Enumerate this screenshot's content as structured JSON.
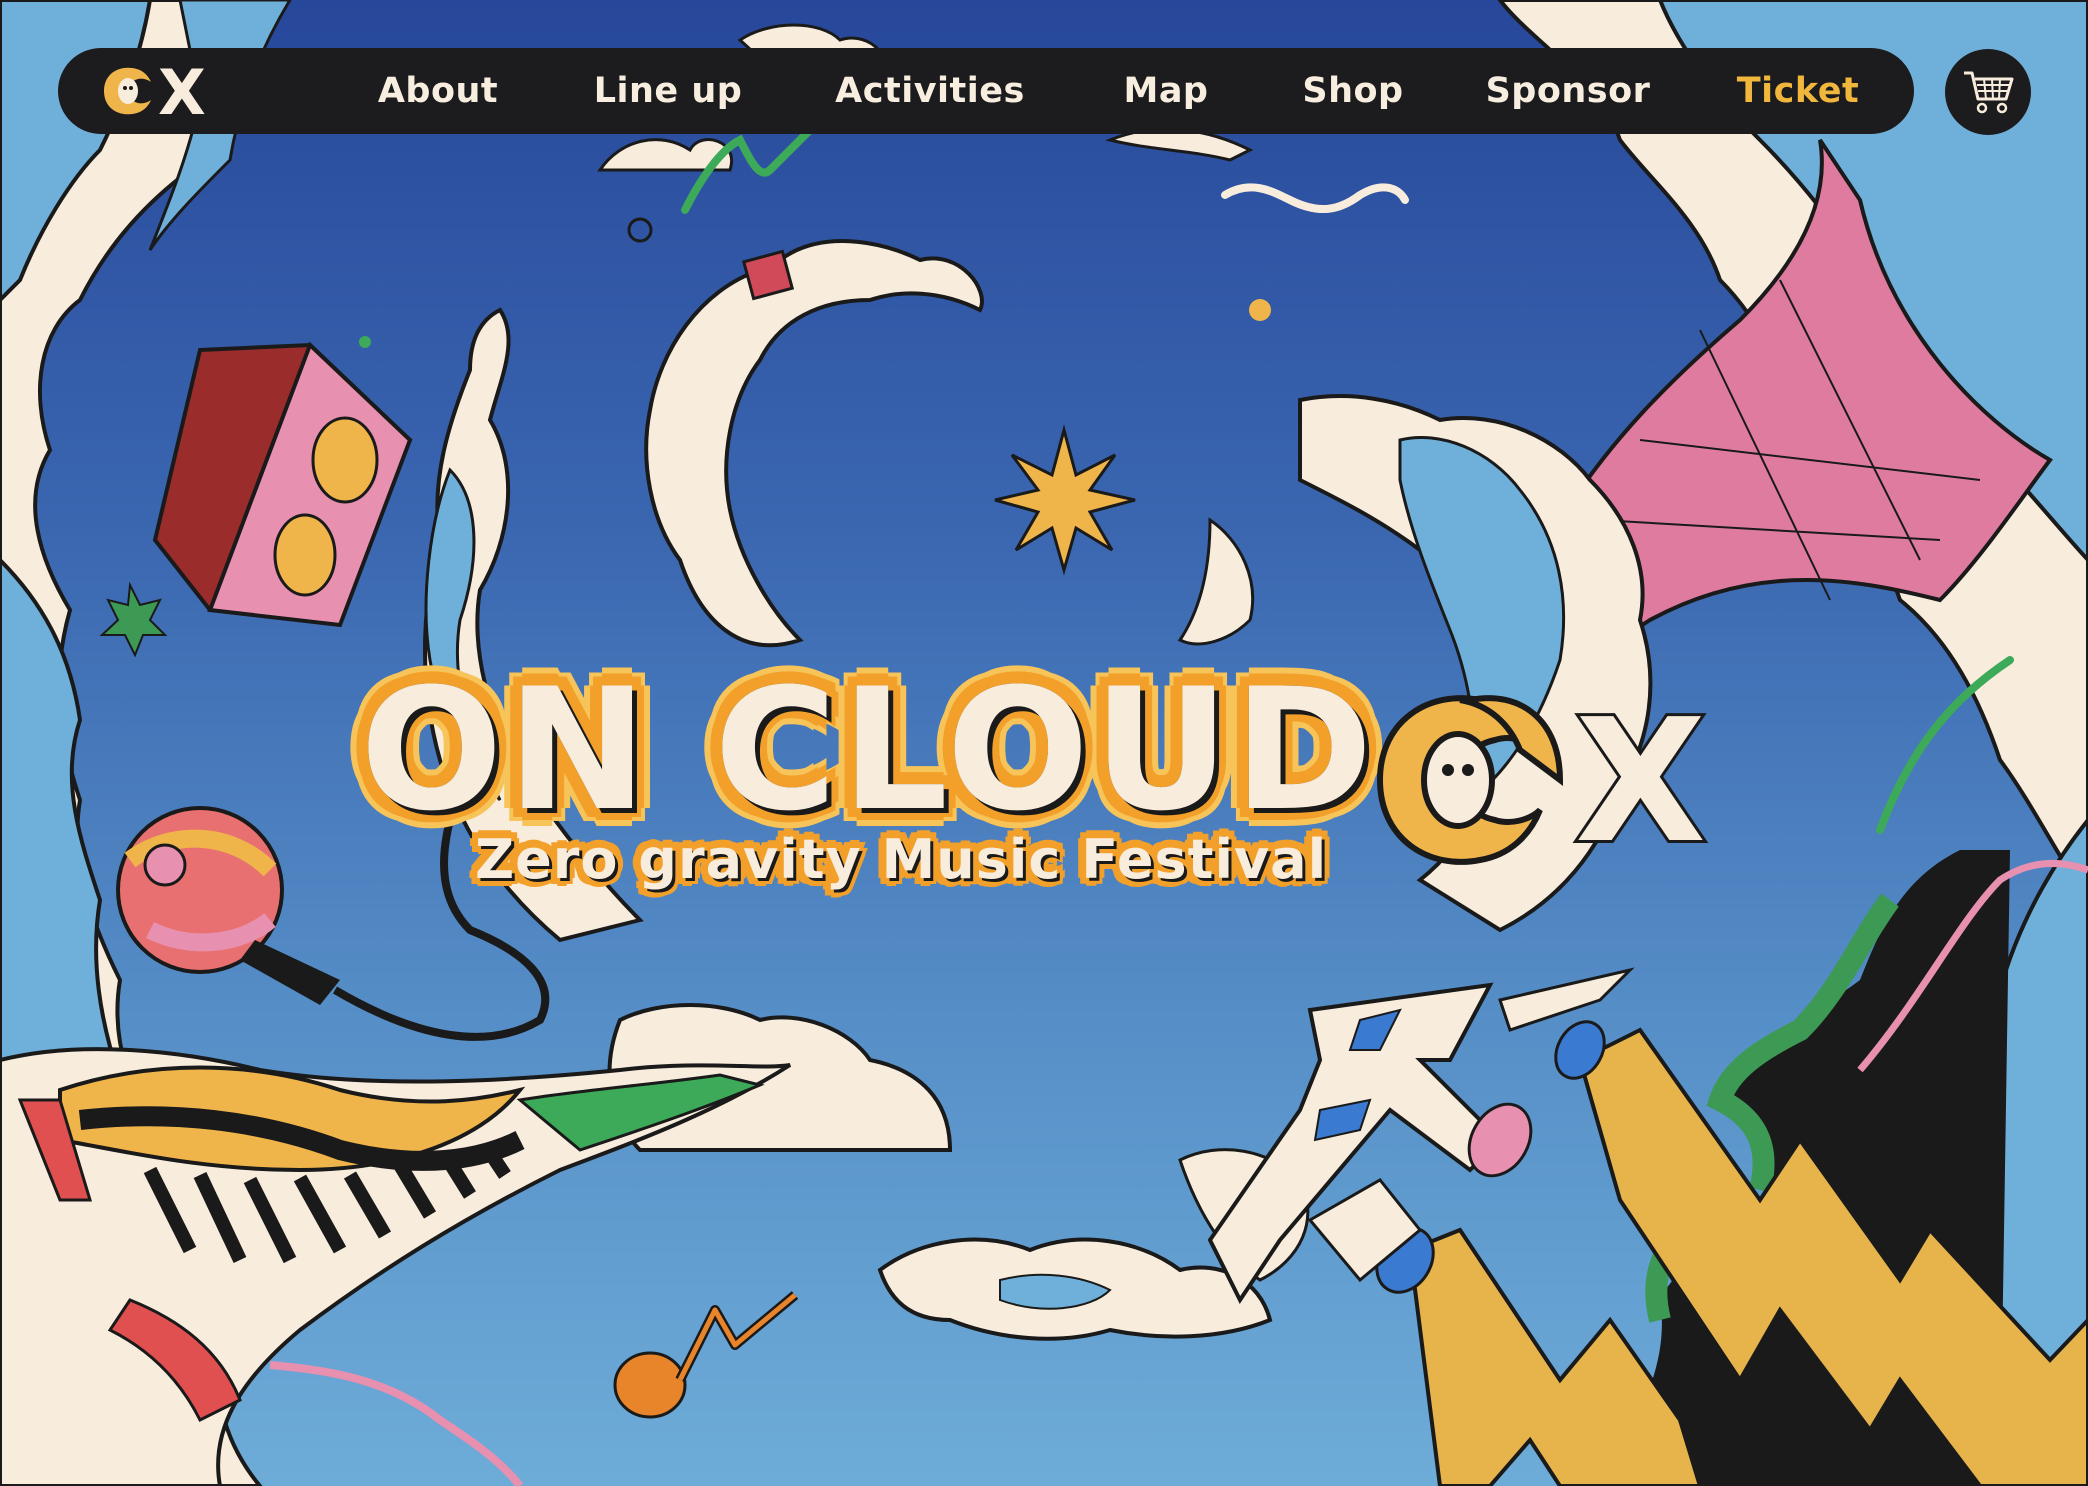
{
  "nav": {
    "logo_text": "X",
    "items": [
      {
        "label": "About"
      },
      {
        "label": "Line up"
      },
      {
        "label": "Activities"
      },
      {
        "label": "Map"
      },
      {
        "label": "Shop"
      },
      {
        "label": "Sponsor"
      },
      {
        "label": "Ticket"
      }
    ]
  },
  "hero": {
    "title": "ON CLOUD",
    "title_logo_text": "X",
    "subtitle": "Zero gravity Music Festival"
  },
  "colors": {
    "nav_bg": "#1c1b1d",
    "nav_text": "#f7eee0",
    "accent": "#f1b73c",
    "sky_top": "#27479a",
    "sky_bottom": "#6eacd8",
    "cloud": "#f8ecdc",
    "pink": "#e07ba0",
    "orange": "#f2a02a"
  },
  "icons": [
    "cart-icon",
    "logo-icon",
    "star-icon",
    "speaker-icon",
    "microphone-icon",
    "piano-icon",
    "spaceship-icon",
    "music-note-icon",
    "lightning-icon"
  ]
}
